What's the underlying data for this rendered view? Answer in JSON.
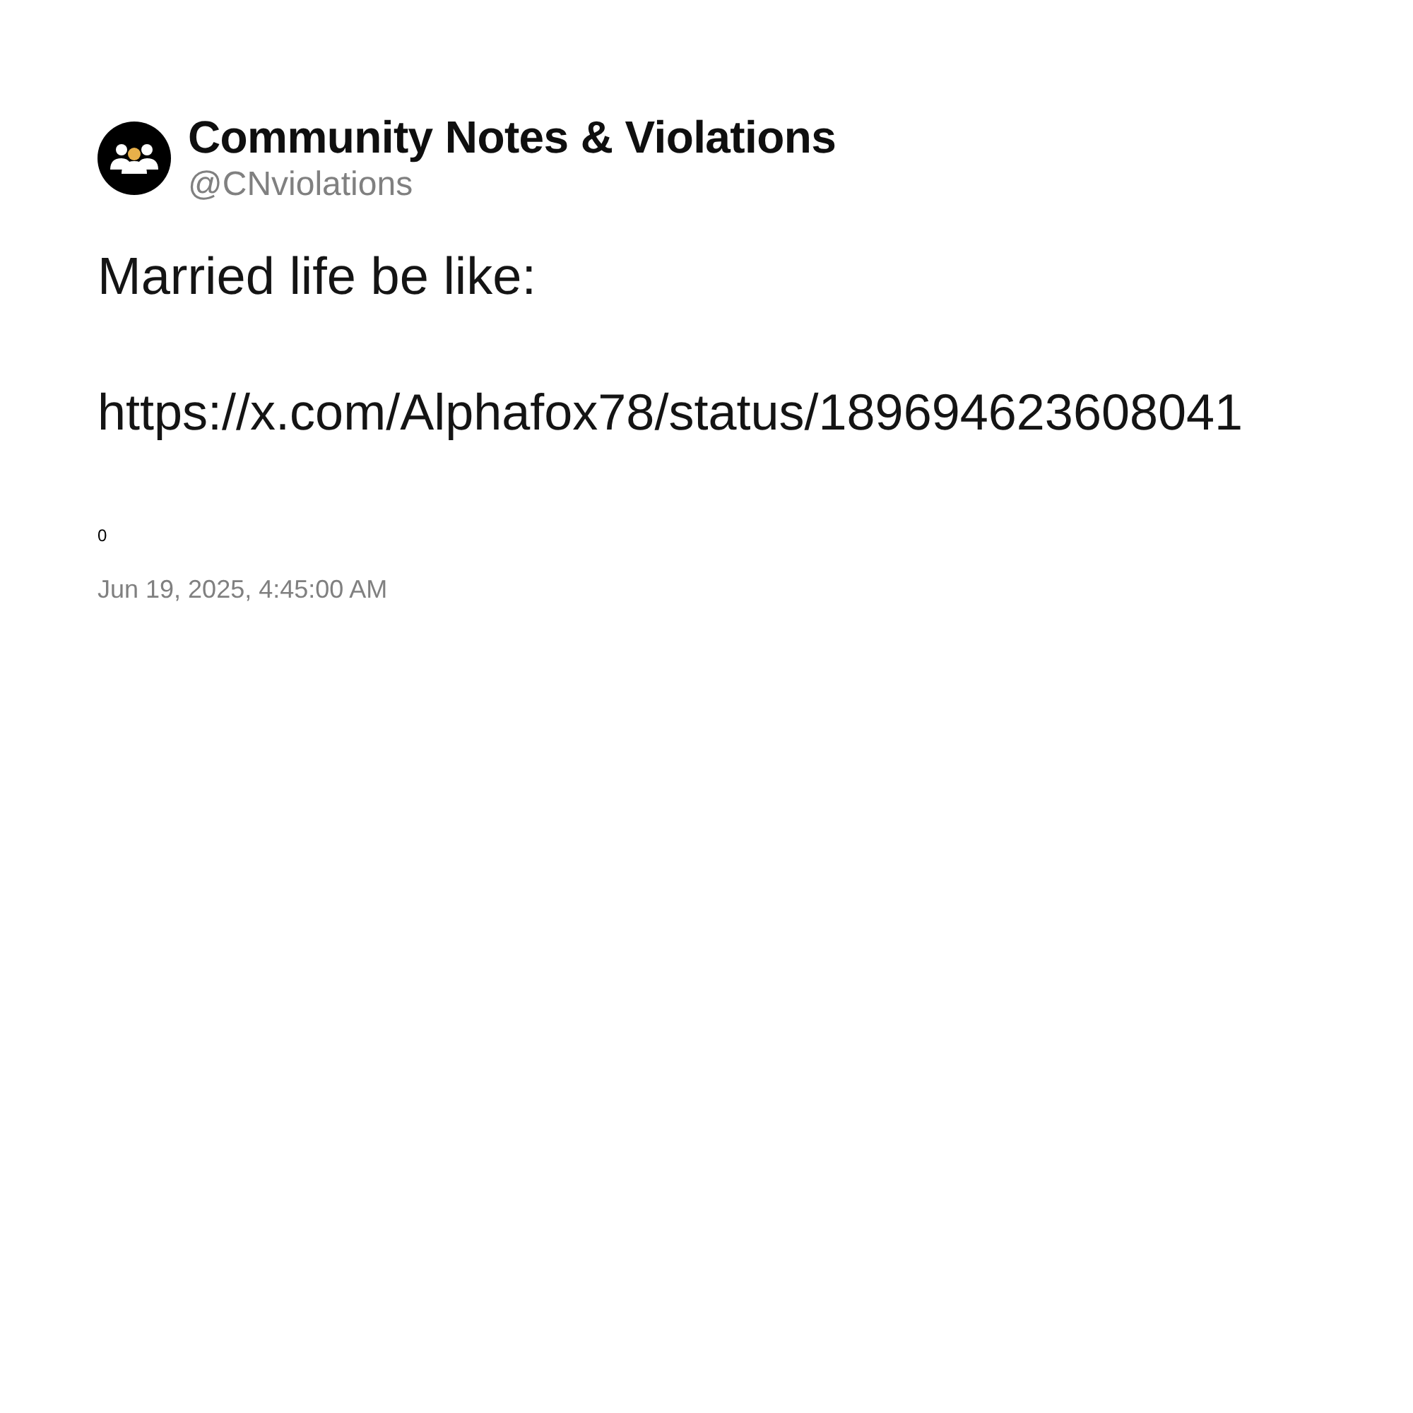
{
  "author": {
    "name": "Community Notes & Violations",
    "handle": "@CNviolations"
  },
  "post": {
    "text": "Married life be like:",
    "link": "https://x.com/Alphafox78/status/189694623608041",
    "count": "0",
    "timestamp": "Jun 19, 2025, 4:45:00 AM"
  }
}
